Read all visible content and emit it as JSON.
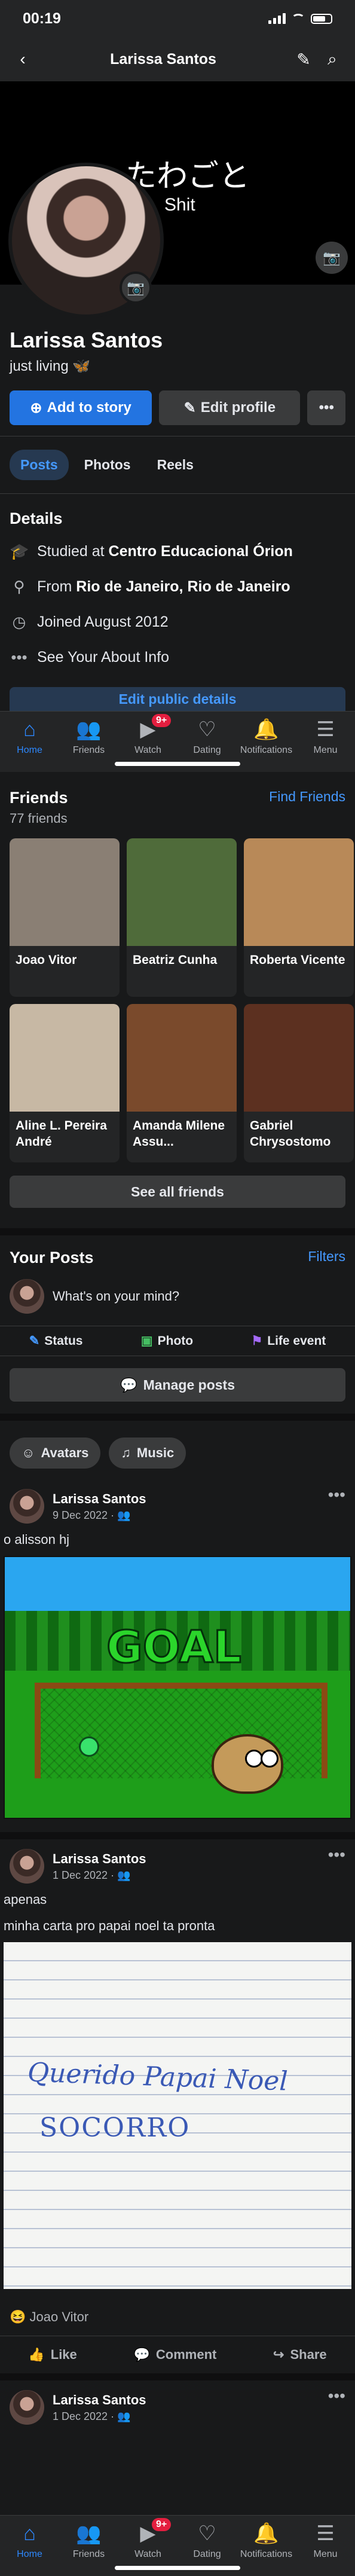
{
  "status_bar": {
    "time": "00:19"
  },
  "top_nav": {
    "title": "Larissa Santos"
  },
  "cover": {
    "line1": "たわごと",
    "line2": "Shit"
  },
  "profile": {
    "name": "Larissa Santos",
    "bio": "just living",
    "bio_emoji": "🦋",
    "add_story_label": "Add to story",
    "edit_profile_label": "Edit profile",
    "more_label": "•••"
  },
  "tabs": [
    {
      "label": "Posts"
    },
    {
      "label": "Photos"
    },
    {
      "label": "Reels"
    }
  ],
  "details": {
    "title": "Details",
    "studied_prefix": "Studied at ",
    "studied_at": "Centro Educacional Órion",
    "from_prefix": "From ",
    "from": "Rio de Janeiro, Rio de Janeiro",
    "joined": "Joined August 2012",
    "about": "See Your About Info",
    "edit_public": "Edit public details"
  },
  "bottom_nav": {
    "items": [
      {
        "label": "Home",
        "icon": "⌂"
      },
      {
        "label": "Friends",
        "icon": "👥"
      },
      {
        "label": "Watch",
        "icon": "▶"
      },
      {
        "label": "Dating",
        "icon": "♡"
      },
      {
        "label": "Notifications",
        "icon": "🔔"
      },
      {
        "label": "Menu",
        "icon": "☰"
      }
    ],
    "watch_badge": "9+"
  },
  "friends": {
    "title": "Friends",
    "find_label": "Find Friends",
    "count": "77 friends",
    "list": [
      {
        "name": "Joao Vitor",
        "color": "#8a7f74"
      },
      {
        "name": "Beatriz Cunha",
        "color": "#4f6b3a"
      },
      {
        "name": "Roberta Vicente",
        "color": "#b88958"
      },
      {
        "name": "Aline L. Pereira André",
        "color": "#c7b8a4"
      },
      {
        "name": "Amanda Milene Assu...",
        "color": "#7a4a2c"
      },
      {
        "name": "Gabriel Chrysostomo",
        "color": "#5c3020"
      }
    ],
    "see_all": "See all friends"
  },
  "your_posts": {
    "title": "Your Posts",
    "filters": "Filters",
    "composer_placeholder": "What's on your mind?",
    "status": "Status",
    "photo": "Photo",
    "life_event": "Life event",
    "manage": "Manage posts"
  },
  "chips": [
    {
      "label": "Avatars",
      "icon": "☺"
    },
    {
      "label": "Music",
      "icon": "♫"
    }
  ],
  "posts": [
    {
      "author": "Larissa Santos",
      "date": "9 Dec 2022 · 👥",
      "text": "o alisson hj",
      "image_text": "GOAL"
    },
    {
      "author": "Larissa Santos",
      "date": "1 Dec 2022 · 👥",
      "text": "apenas"
    },
    {
      "caption": "minha carta pro papai noel ta pronta",
      "letter_line1": "Querido Papai Noel",
      "letter_line2": "SOCORRO",
      "reaction": "Joao Vitor"
    },
    {
      "author": "Larissa Santos",
      "date": "1 Dec 2022 · 👥"
    }
  ],
  "post_actions": {
    "like": "Like",
    "comment": "Comment",
    "share": "Share"
  },
  "colors": {
    "accent": "#2374e1",
    "link": "#4599ff",
    "background": "#18191a",
    "badge": "#e41e3f"
  }
}
